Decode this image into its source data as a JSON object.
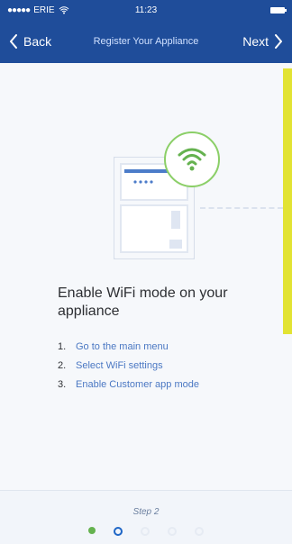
{
  "status": {
    "carrier": "ERIE",
    "time": "11:23"
  },
  "nav": {
    "back_label": "Back",
    "title": "Register Your Appliance",
    "next_label": "Next"
  },
  "content": {
    "headline": "Enable WiFi mode on your appliance",
    "steps": [
      {
        "num": "1.",
        "text": "Go to the main menu"
      },
      {
        "num": "2.",
        "text": "Select WiFi settings"
      },
      {
        "num": "3.",
        "text": "Enable Customer app mode"
      }
    ]
  },
  "footer": {
    "step_label": "Step 2",
    "pager": [
      {
        "state": "complete"
      },
      {
        "state": "active"
      },
      {
        "state": "inactive"
      },
      {
        "state": "inactive"
      },
      {
        "state": "inactive"
      }
    ]
  },
  "colors": {
    "nav_bg": "#1f4d9a",
    "accent_green": "#65b24f",
    "link_blue": "#4b78c3",
    "side_yellow": "#e2e333"
  }
}
